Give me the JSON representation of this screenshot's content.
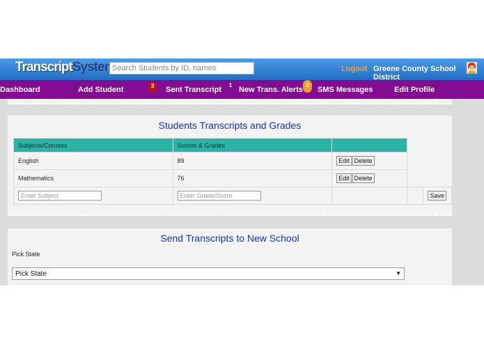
{
  "header": {
    "logo_part1": "Transcript",
    "logo_part2": "System",
    "search_placeholder": "Search Students by ID, names",
    "logout": "Logout",
    "district": "Greene County School District"
  },
  "nav": {
    "dashboard": "Dashboard",
    "add_student": "Add Student",
    "sent_badge": "3",
    "sent_transcript": "Sent Transcript",
    "alerts_badge": "1",
    "new_alerts": "New Trans. Alerts",
    "sms_badge": "3",
    "sms": "SMS Messages",
    "edit_profile": "Edit Profile"
  },
  "transcripts": {
    "title": "Students Transcripts and Grades",
    "col_subject": "Subjects/Coruses",
    "col_score": "Scores & Grades",
    "rows": [
      {
        "subject": "English",
        "score": "89"
      },
      {
        "subject": "Mathematics",
        "score": "76"
      }
    ],
    "edit_label": "Edit",
    "delete_label": "Delete",
    "subject_placeholder": "Enter Subject",
    "grade_placeholder": "Enter Grade/Score",
    "save_label": "Save"
  },
  "send": {
    "title": "Send Transcripts to New School",
    "pick_label": "Pick State",
    "select_value": "Pick State"
  },
  "colors": {
    "header_blue": "#1f6fc4",
    "nav_purple": "#820c92",
    "table_header_teal": "#2bb3a6",
    "title_blue": "#1a2fc8",
    "logout_orange": "#f0a030"
  }
}
